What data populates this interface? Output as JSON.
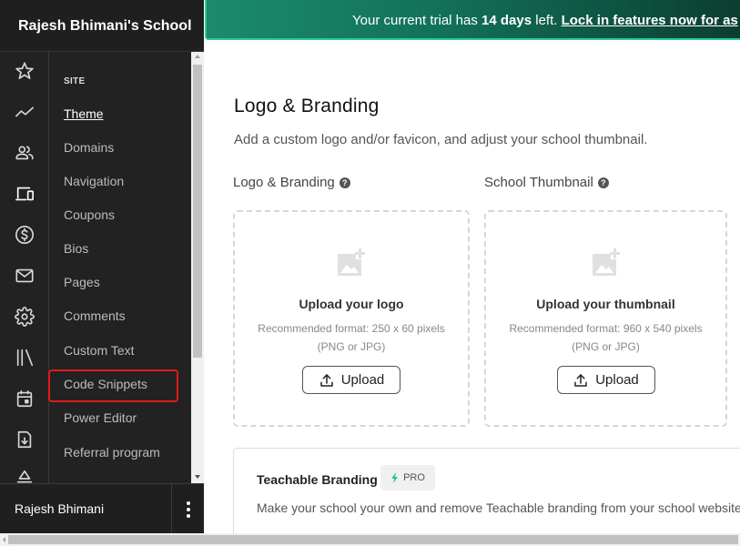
{
  "sidebar": {
    "school_name": "Rajesh Bhimani's School",
    "rail_icons": [
      "star-icon",
      "analytics-icon",
      "users-icon",
      "devices-icon",
      "dollar-icon",
      "mail-icon",
      "gear-icon",
      "library-icon",
      "calendar-icon",
      "file-download-icon",
      "shapes-icon"
    ],
    "section_label": "SITE",
    "items": [
      {
        "label": "Theme",
        "active": true
      },
      {
        "label": "Domains"
      },
      {
        "label": "Navigation"
      },
      {
        "label": "Coupons"
      },
      {
        "label": "Bios"
      },
      {
        "label": "Pages"
      },
      {
        "label": "Comments"
      },
      {
        "label": "Custom Text"
      },
      {
        "label": "Code Snippets",
        "highlighted": true
      },
      {
        "label": "Power Editor"
      },
      {
        "label": "Referral program"
      }
    ],
    "user_name": "Rajesh Bhimani",
    "highlight_color": "#e01b1b"
  },
  "banner": {
    "text_prefix": "Your current trial has ",
    "days": "14 days",
    "text_middle": " left. ",
    "link_text": "Lock in features now for as"
  },
  "main": {
    "title": "Logo & Branding",
    "subtitle": "Add a custom logo and/or favicon, and adjust your school thumbnail.",
    "logo": {
      "label": "Logo & Branding",
      "upload_title": "Upload your logo",
      "recommended": "Recommended format: 250 x 60 pixels",
      "format": "(PNG or JPG)",
      "button": "Upload"
    },
    "thumbnail": {
      "label": "School Thumbnail",
      "upload_title": "Upload your thumbnail",
      "recommended": "Recommended format: 960 x 540 pixels",
      "format": "(PNG or JPG)",
      "button": "Upload"
    },
    "branding": {
      "title": "Teachable Branding",
      "badge": "PRO",
      "description": "Make your school your own and remove Teachable branding from your school website"
    }
  },
  "colors": {
    "banner_start": "#1c8a6e",
    "banner_end": "#0b3e30",
    "sidebar_bg": "#222222",
    "pro_accent": "#2fc38f"
  }
}
